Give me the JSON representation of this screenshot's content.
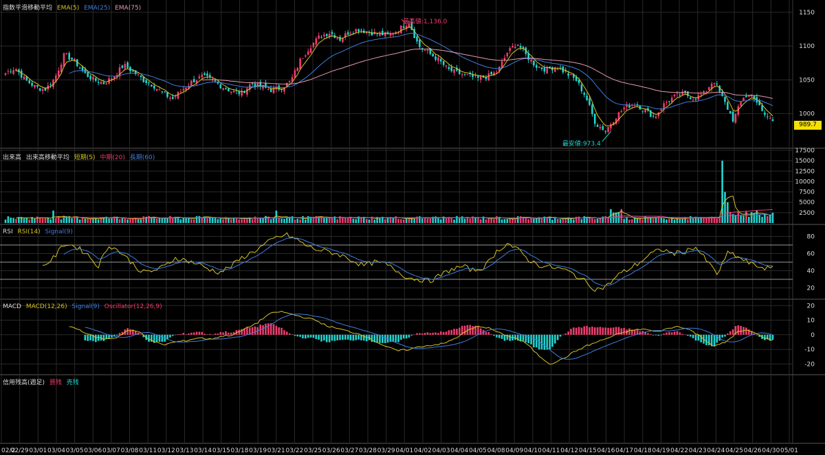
{
  "panels": {
    "price": {
      "title": "指数平滑移動平均",
      "legend": [
        {
          "label": "EMA(5)",
          "color": "#d6c425"
        },
        {
          "label": "EMA(25)",
          "color": "#3f7fe0"
        },
        {
          "label": "EMA(75)",
          "color": "#e89ab0"
        }
      ],
      "yticks": [
        "1150",
        "1100",
        "1050",
        "1000"
      ],
      "yrange": [
        955,
        1160
      ],
      "last_price": "989.7",
      "high_label": "最高値:1,136.0",
      "low_label": "最安値:973.4"
    },
    "volume": {
      "title": "出来高",
      "subtitle": "出来高移動平均",
      "legend": [
        {
          "label": "短期(5)",
          "color": "#d6c425"
        },
        {
          "label": "中期(20)",
          "color": "#f03c6e"
        },
        {
          "label": "長期(60)",
          "color": "#3f7fe0"
        }
      ],
      "yticks": [
        "17500",
        "15000",
        "12500",
        "10000",
        "7500",
        "5000",
        "2500"
      ],
      "yrange": [
        0,
        17500
      ]
    },
    "rsi": {
      "title": "RSI",
      "legend": [
        {
          "label": "RSI(14)",
          "color": "#d6c425"
        },
        {
          "label": "Signal(9)",
          "color": "#3f7fe0"
        }
      ],
      "yticks": [
        "80",
        "60",
        "40",
        "20"
      ],
      "yrange": [
        10,
        90
      ],
      "guides": [
        70,
        50,
        30
      ]
    },
    "macd": {
      "title": "MACD",
      "legend": [
        {
          "label": "MACD(12,26)",
          "color": "#d6c425"
        },
        {
          "label": "Signal(9)",
          "color": "#3f7fe0"
        },
        {
          "label": "Oscillator(12,26,9)",
          "color": "#f03c6e"
        }
      ],
      "yticks": [
        "20",
        "10",
        "0",
        "-10",
        "-20"
      ],
      "yrange": [
        -25,
        22
      ]
    },
    "credit": {
      "title": "信用残高(週足)",
      "legend": [
        {
          "label": "買残",
          "color": "#f03c6e"
        },
        {
          "label": "売残",
          "color": "#21d4cf"
        }
      ]
    }
  },
  "x_axis_labels": [
    "02/2",
    "02/29",
    "03/01",
    "03/04",
    "03/05",
    "03/06",
    "03/07",
    "03/08",
    "03/11",
    "03/12",
    "03/13",
    "03/14",
    "03/15",
    "03/18",
    "03/19",
    "03/21",
    "03/22",
    "03/25",
    "03/26",
    "03/27",
    "03/28",
    "03/29",
    "04/01",
    "04/02",
    "04/03",
    "04/04",
    "04/05",
    "04/08",
    "04/09",
    "04/10",
    "04/11",
    "04/12",
    "04/15",
    "04/16",
    "04/17",
    "04/18",
    "04/19",
    "04/22",
    "04/23",
    "04/24",
    "04/25",
    "04/26",
    "04/30",
    "05/01"
  ],
  "colors": {
    "up": "#f03c6e",
    "down": "#21d4cf",
    "grid": "#2a2a2a",
    "sep": "#5a5a5a"
  },
  "chart_data": {
    "type": "candlestick",
    "price_anchors": [
      1060,
      1068,
      1050,
      1040,
      1035,
      1052,
      1088,
      1078,
      1060,
      1050,
      1045,
      1055,
      1072,
      1062,
      1050,
      1042,
      1030,
      1022,
      1036,
      1048,
      1055,
      1050,
      1040,
      1033,
      1030,
      1045,
      1040,
      1035,
      1038,
      1048,
      1080,
      1100,
      1115,
      1120,
      1110,
      1122,
      1125,
      1120,
      1118,
      1116,
      1125,
      1136,
      1100,
      1090,
      1080,
      1065,
      1060,
      1056,
      1052,
      1055,
      1062,
      1090,
      1105,
      1085,
      1070,
      1065,
      1070,
      1060,
      1050,
      1025,
      985,
      975,
      995,
      1010,
      1015,
      1005,
      995,
      1015,
      1025,
      1030,
      1022,
      1030,
      1050,
      1020,
      990,
      1025,
      1028,
      1000,
      990
    ],
    "rsi_anchors": [
      45,
      55,
      72,
      68,
      60,
      45,
      70,
      62,
      50,
      38,
      40,
      45,
      55,
      52,
      48,
      42,
      38,
      45,
      55,
      62,
      70,
      78,
      82,
      76,
      68,
      64,
      62,
      58,
      52,
      46,
      50,
      48,
      40,
      32,
      30,
      28,
      35,
      42,
      45,
      40,
      45,
      62,
      72,
      64,
      52,
      46,
      44,
      42,
      36,
      28,
      18,
      22,
      35,
      42,
      50,
      60,
      65,
      60,
      62,
      68,
      52,
      36,
      62,
      55,
      48,
      44,
      42
    ],
    "macd_anchors": [
      6,
      3,
      -1,
      -3,
      -2,
      3,
      2,
      -4,
      -7,
      -5,
      -4,
      -2,
      -3,
      -1,
      0,
      4,
      8,
      14,
      16,
      14,
      12,
      10,
      6,
      4,
      2,
      0,
      -4,
      -8,
      -11,
      -10,
      -8,
      -7,
      -6,
      -2,
      3,
      6,
      4,
      0,
      -2,
      -6,
      -14,
      -20,
      -17,
      -12,
      -8,
      -5,
      -2,
      1,
      3,
      4,
      2,
      4,
      6,
      3,
      -2,
      -8,
      -5,
      2,
      3,
      -1,
      -4
    ],
    "volume_spike_values": [
      15000,
      7500,
      5000
    ],
    "high": 1136.0,
    "low": 973.4,
    "last": 989.7
  }
}
